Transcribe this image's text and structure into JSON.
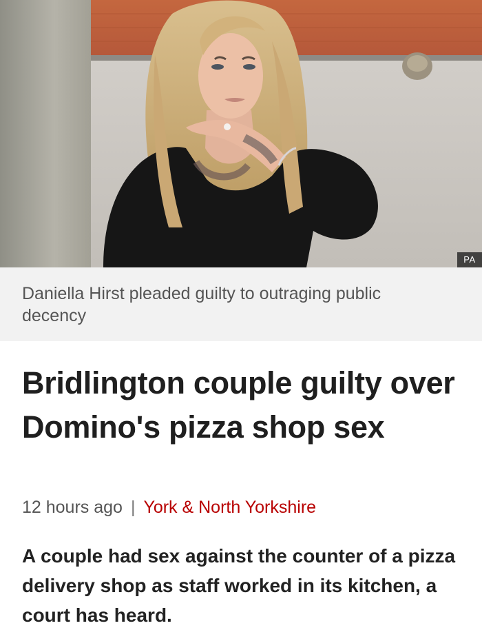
{
  "image": {
    "credit": "PA"
  },
  "caption": {
    "text": "Daniella Hirst pleaded guilty to outraging public decency"
  },
  "article": {
    "headline": "Bridlington couple guilty over Domino's pizza shop sex",
    "timestamp": "12 hours ago",
    "separator": "|",
    "topic": "York & North Yorkshire",
    "summary": "A couple had sex against the counter of a pizza delivery shop as staff worked in its kitchen, a court has heard."
  },
  "colors": {
    "topic_link": "#b80000",
    "caption_background": "#f2f2f2",
    "headline": "#1f1f1f"
  }
}
